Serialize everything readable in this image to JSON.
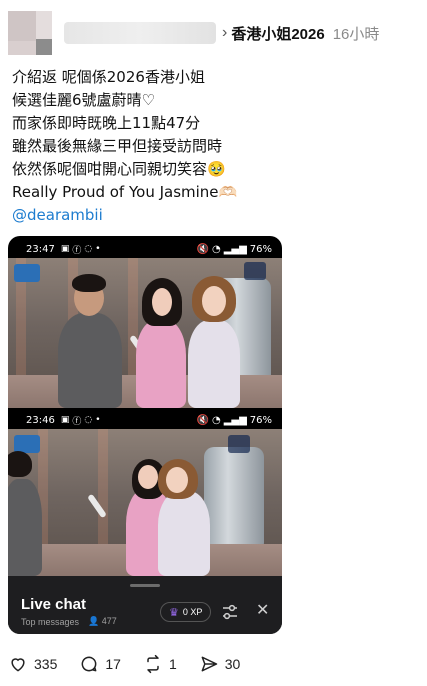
{
  "header": {
    "community": "香港小姐2026",
    "time_ago": "16小時"
  },
  "post": {
    "lines": [
      "介紹返 呢個係2026香港小姐",
      "候選佳麗6號盧蔚晴♡",
      "而家係即時既晚上11點47分",
      "雖然最後無緣三甲但接受訪問時",
      "依然係呢個咁開心同親切笑容🥹",
      "Really Proud of You Jasmine🫶🏻"
    ],
    "mention": "@dearambii"
  },
  "media": {
    "top_status": {
      "time": "23:47",
      "battery": "76%"
    },
    "bottom_status": {
      "time": "23:46",
      "battery": "76%"
    },
    "live": {
      "title": "Live chat",
      "subtitle": "Top messages",
      "viewers": "477",
      "xp": "0 XP"
    }
  },
  "actions": {
    "likes": "335",
    "replies": "17",
    "reposts": "1",
    "shares": "30"
  },
  "colors": {
    "mention": "#1d7ccf",
    "livebar": "#1e1e20"
  }
}
